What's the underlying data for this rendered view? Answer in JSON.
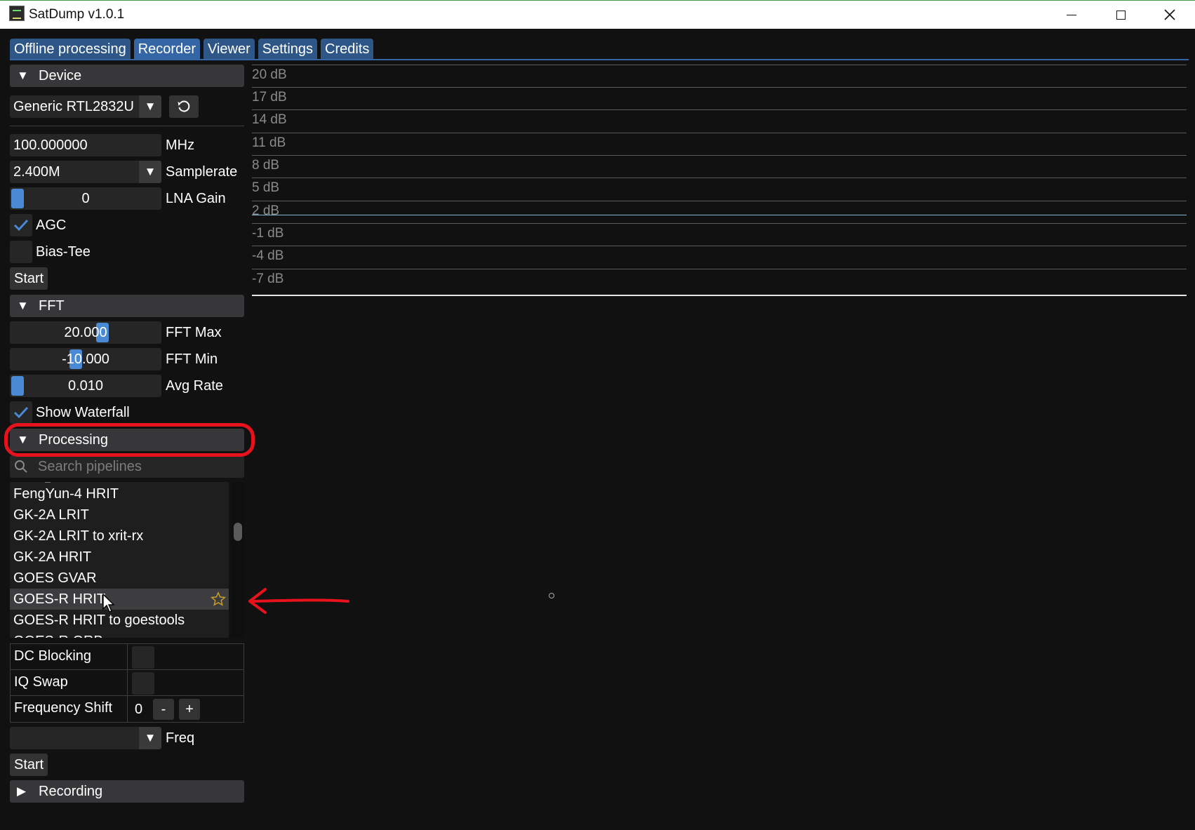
{
  "window": {
    "title": "SatDump v1.0.1"
  },
  "tabs": [
    {
      "label": "Offline processing",
      "active": false
    },
    {
      "label": "Recorder",
      "active": true
    },
    {
      "label": "Viewer",
      "active": false
    },
    {
      "label": "Settings",
      "active": false
    },
    {
      "label": "Credits",
      "active": false
    }
  ],
  "device": {
    "header": "Device",
    "selected_device": "Generic RTL2832U",
    "frequency": {
      "value": "100.000000",
      "label": "MHz"
    },
    "samplerate": {
      "value": "2.400M",
      "label": "Samplerate"
    },
    "lna_gain": {
      "value": "0",
      "label": "LNA Gain"
    },
    "agc": {
      "label": "AGC",
      "checked": true
    },
    "bias_tee": {
      "label": "Bias-Tee",
      "checked": false
    },
    "start_label": "Start"
  },
  "fft": {
    "header": "FFT",
    "fft_max": {
      "value": "20.000",
      "label": "FFT Max"
    },
    "fft_min": {
      "value": "-10.000",
      "label": "FFT Min"
    },
    "avg_rate": {
      "value": "0.010",
      "label": "Avg Rate"
    },
    "show_waterfall": {
      "label": "Show Waterfall",
      "checked": true
    }
  },
  "processing": {
    "header": "Processing",
    "search_placeholder": "Search pipelines",
    "pipelines": [
      "FengYun-4 HRIT",
      "GK-2A LRIT",
      "GK-2A LRIT to xrit-rx",
      "GK-2A HRIT",
      "GOES GVAR",
      "GOES-R HRIT",
      "GOES-R HRIT to goestools",
      "GOES-R GRB"
    ],
    "selected_pipeline": "GOES-R HRIT",
    "dc_blocking": "DC Blocking",
    "iq_swap": "IQ Swap",
    "frequency_shift": {
      "label": "Frequency Shift",
      "value": "0",
      "minus": "-",
      "plus": "+"
    },
    "freq_label": "Freq",
    "start_label": "Start"
  },
  "recording": {
    "header": "Recording"
  },
  "plot": {
    "db_labels": [
      "20 dB",
      "17 dB",
      "14 dB",
      "11 dB",
      "8 dB",
      "5 dB",
      "2 dB",
      "-1 dB",
      "-4 dB",
      "-7 dB"
    ]
  },
  "colors": {
    "tab_active": "#3465a4",
    "tab_inactive": "#2e5787",
    "annotation": "#e8121d",
    "slider_grab": "#4a8ad4"
  }
}
